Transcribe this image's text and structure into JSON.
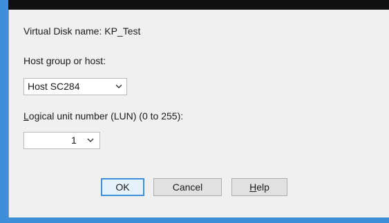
{
  "dialog": {
    "vdisk_label": "Virtual Disk name: KP_Test",
    "host_label_pre": "Host ",
    "host_label_mnemonic": "g",
    "host_label_post": "roup or host:",
    "host_select_value": "Host SC284",
    "lun_label_mnemonic": "L",
    "lun_label_post": "ogical unit number (LUN) (0 to 255):",
    "lun_select_value": "1",
    "ok_label": "OK",
    "cancel_label": "Cancel",
    "help_mnemonic": "H",
    "help_post": "elp"
  },
  "colors": {
    "accent_border": "#3c8fd8",
    "title_bar": "#101010",
    "dialog_bg": "#f0f0f0"
  },
  "icons": [
    "chevron-down-icon"
  ]
}
